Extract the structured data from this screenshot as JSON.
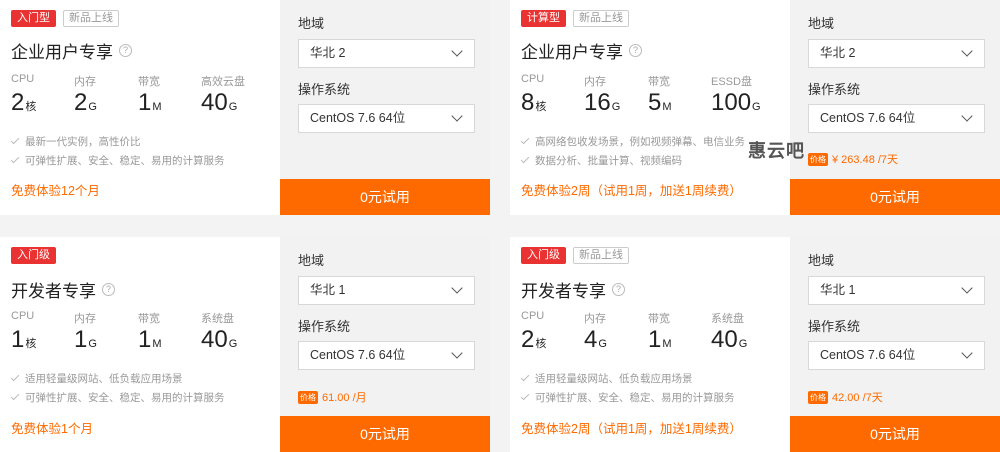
{
  "cards": [
    {
      "tags": [
        {
          "text": "入门型",
          "style": "red"
        },
        {
          "text": "新品上线",
          "style": "gray"
        }
      ],
      "title": "企业用户专享",
      "specs": [
        {
          "label": "CPU",
          "value": "2",
          "unit": "核"
        },
        {
          "label": "内存",
          "value": "2",
          "unit": "G"
        },
        {
          "label": "带宽",
          "value": "1",
          "unit": "M"
        },
        {
          "label": "高效云盘",
          "value": "40",
          "unit": "G"
        }
      ],
      "features": [
        "最新一代实例，高性价比",
        "可弹性扩展、安全、稳定、易用的计算服务"
      ],
      "promo": "免费体验12个月",
      "region_label": "地域",
      "region": "华北 2",
      "os_label": "操作系统",
      "os": "CentOS 7.6 64位",
      "price_tag": "",
      "price": "",
      "button": "0元试用"
    },
    {
      "tags": [
        {
          "text": "计算型",
          "style": "red"
        },
        {
          "text": "新品上线",
          "style": "gray"
        }
      ],
      "title": "企业用户专享",
      "specs": [
        {
          "label": "CPU",
          "value": "8",
          "unit": "核"
        },
        {
          "label": "内存",
          "value": "16",
          "unit": "G"
        },
        {
          "label": "带宽",
          "value": "5",
          "unit": "M"
        },
        {
          "label": "ESSD盘",
          "value": "100",
          "unit": "G"
        }
      ],
      "features": [
        "高网络包收发场景，例如视频弹幕、电信业务",
        "数据分析、批量计算、视频编码"
      ],
      "promo": "免费体验2周（试用1周，加送1周续费）",
      "region_label": "地域",
      "region": "华北 2",
      "os_label": "操作系统",
      "os": "CentOS 7.6 64位",
      "price_tag": "价格",
      "price": "¥ 263.48 /7天",
      "button": "0元试用"
    },
    {
      "tags": [
        {
          "text": "入门级",
          "style": "red"
        }
      ],
      "title": "开发者专享",
      "specs": [
        {
          "label": "CPU",
          "value": "1",
          "unit": "核"
        },
        {
          "label": "内存",
          "value": "1",
          "unit": "G"
        },
        {
          "label": "带宽",
          "value": "1",
          "unit": "M"
        },
        {
          "label": "系统盘",
          "value": "40",
          "unit": "G"
        }
      ],
      "features": [
        "适用轻量级网站、低负载应用场景",
        "可弹性扩展、安全、稳定、易用的计算服务"
      ],
      "promo": "免费体验1个月",
      "region_label": "地域",
      "region": "华北 1",
      "os_label": "操作系统",
      "os": "CentOS 7.6 64位",
      "price_tag": "价格",
      "price": "61.00 /月",
      "button": "0元试用"
    },
    {
      "tags": [
        {
          "text": "入门级",
          "style": "red"
        },
        {
          "text": "新品上线",
          "style": "gray"
        }
      ],
      "title": "开发者专享",
      "specs": [
        {
          "label": "CPU",
          "value": "2",
          "unit": "核"
        },
        {
          "label": "内存",
          "value": "4",
          "unit": "G"
        },
        {
          "label": "带宽",
          "value": "1",
          "unit": "M"
        },
        {
          "label": "系统盘",
          "value": "40",
          "unit": "G"
        }
      ],
      "features": [
        "适用轻量级网站、低负载应用场景",
        "可弹性扩展、安全、稳定、易用的计算服务"
      ],
      "promo": "免费体验2周（试用1周，加送1周续费）",
      "region_label": "地域",
      "region": "华北 1",
      "os_label": "操作系统",
      "os": "CentOS 7.6 64位",
      "price_tag": "价格",
      "price": "42.00 /7天",
      "button": "0元试用"
    }
  ],
  "watermark": "惠云吧",
  "colors": {
    "accent": "#ff6a00",
    "tag_red": "#e93333"
  },
  "icons": {
    "help": "question-circle-icon",
    "check": "check-icon",
    "dropdown": "chevron-down-icon"
  }
}
